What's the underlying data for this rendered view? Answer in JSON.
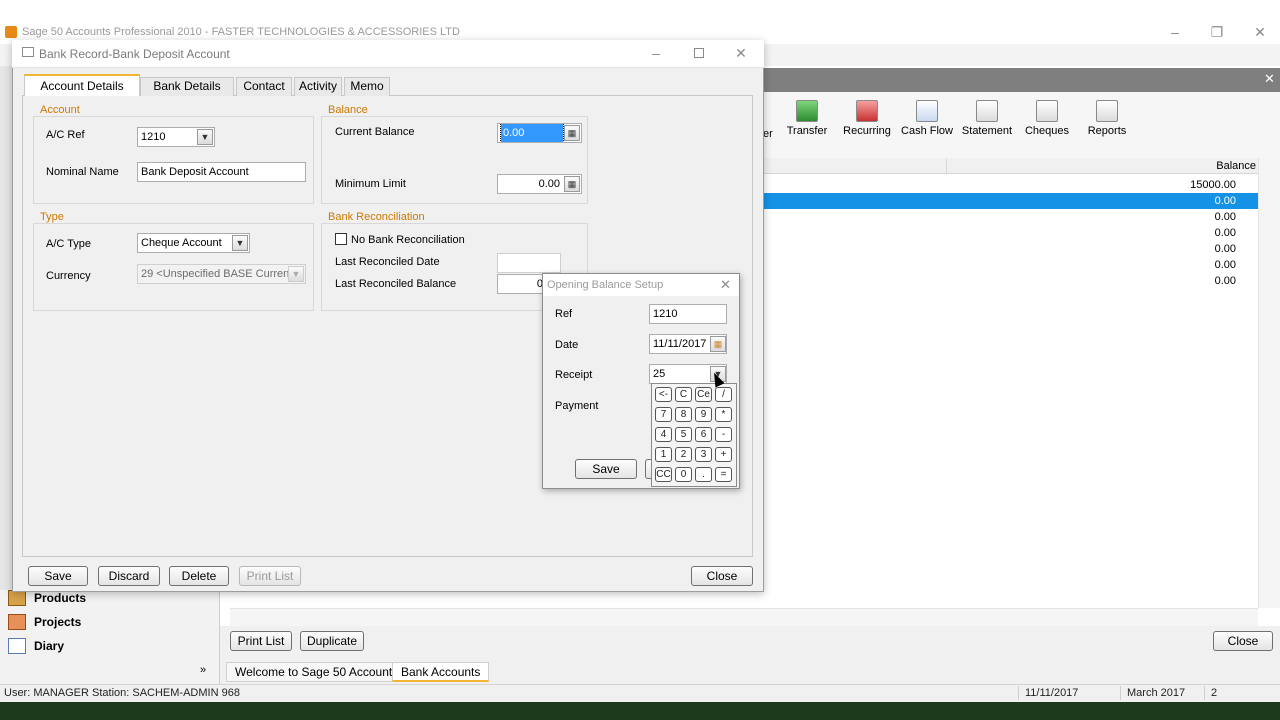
{
  "app": {
    "title": "Sage 50 Accounts Professional 2010 - FASTER TECHNOLOGIES & ACCESSORIES LTD",
    "window_controls": [
      "–",
      "❐",
      "✕"
    ],
    "close_workspace": "✕"
  },
  "toolbar": {
    "partial_label": "er",
    "buttons": [
      {
        "label": "Transfer",
        "icon": "transfer-icon"
      },
      {
        "label": "Recurring",
        "icon": "recurring-icon"
      },
      {
        "label": "Cash Flow",
        "icon": "cash-flow-icon"
      },
      {
        "label": "Statement",
        "icon": "statement-icon"
      },
      {
        "label": "Cheques",
        "icon": "cheques-icon"
      },
      {
        "label": "Reports",
        "icon": "reports-icon"
      }
    ]
  },
  "grid": {
    "column_balance": "Balance",
    "rows": [
      "15000.00",
      "0.00",
      "0.00",
      "0.00",
      "0.00",
      "0.00",
      "0.00"
    ],
    "selected_index": 1
  },
  "left_nav": {
    "items": [
      {
        "label": "Products",
        "icon": "products-icon"
      },
      {
        "label": "Projects",
        "icon": "projects-icon"
      },
      {
        "label": "Diary",
        "icon": "diary-icon"
      }
    ],
    "more": "»"
  },
  "bottom_buttons": {
    "print_list": "Print List",
    "duplicate": "Duplicate",
    "close": "Close"
  },
  "workspace_tabs": [
    "Welcome to Sage 50 Accounts",
    "Bank Accounts"
  ],
  "status_bar": {
    "user": "User: MANAGER Station: SACHEM-ADMIN  968",
    "date": "11/11/2017",
    "period": "March 2017",
    "number": "2"
  },
  "bank_window": {
    "title": "Bank Record-Bank Deposit Account",
    "tabs": [
      "Account Details",
      "Bank Details",
      "Contact",
      "Activity",
      "Memo"
    ],
    "account_group": "Account",
    "ac_ref_label": "A/C Ref",
    "ac_ref_value": "1210",
    "nominal_name_label": "Nominal Name",
    "nominal_name_value": "Bank Deposit Account",
    "balance_group": "Balance",
    "current_balance_label": "Current Balance",
    "current_balance_value": "0.00",
    "minimum_limit_label": "Minimum Limit",
    "minimum_limit_value": "0.00",
    "type_group": "Type",
    "ac_type_label": "A/C Type",
    "ac_type_value": "Cheque Account",
    "currency_label": "Currency",
    "currency_value": "29  <Unspecified BASE Currency",
    "reconciliation_group": "Bank Reconciliation",
    "no_bank_rec_label": "No Bank Reconciliation",
    "last_reconciled_date_label": "Last Reconciled Date",
    "last_reconciled_date_value": "",
    "last_reconciled_balance_label": "Last Reconciled Balance",
    "last_reconciled_balance_value": "0",
    "buttons": {
      "save": "Save",
      "discard": "Discard",
      "delete": "Delete",
      "print_list": "Print List",
      "close": "Close"
    }
  },
  "opening_balance": {
    "title": "Opening Balance Setup",
    "ref_label": "Ref",
    "ref_value": "1210",
    "date_label": "Date",
    "date_value": "11/11/2017",
    "receipt_label": "Receipt",
    "receipt_value": "25",
    "payment_label": "Payment",
    "save": "Save",
    "calculator_keys": [
      [
        "<-",
        "C",
        "Ce",
        "/"
      ],
      [
        "7",
        "8",
        "9",
        "*"
      ],
      [
        "4",
        "5",
        "6",
        "-"
      ],
      [
        "1",
        "2",
        "3",
        "+"
      ],
      [
        "CC",
        "0",
        ".",
        "="
      ]
    ]
  }
}
